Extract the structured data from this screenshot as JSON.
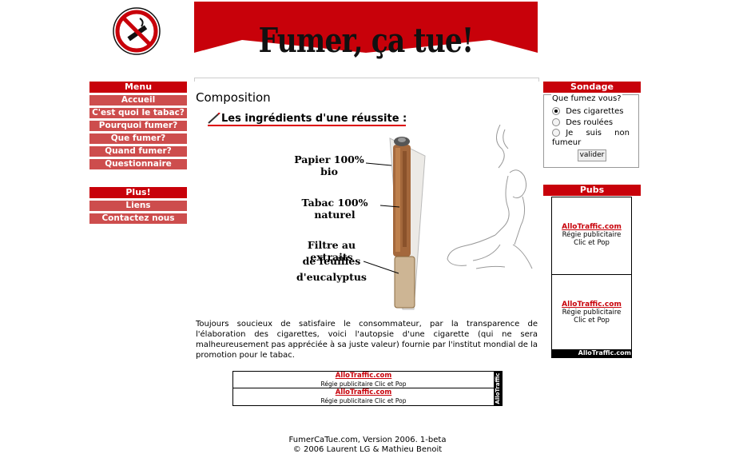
{
  "banner": {
    "title": "Fumer, ça tue!"
  },
  "menu": {
    "title": "Menu",
    "items": [
      {
        "label": "Accueil"
      },
      {
        "label": "C'est quoi le tabac?"
      },
      {
        "label": "Pourquoi fumer?"
      },
      {
        "label": "Que fumer?"
      },
      {
        "label": "Quand fumer?"
      },
      {
        "label": "Questionnaire"
      }
    ]
  },
  "plus": {
    "title": "Plus!",
    "items": [
      {
        "label": "Liens"
      },
      {
        "label": "Contactez nous"
      }
    ]
  },
  "main": {
    "heading": "Composition",
    "subheading": "Les ingrédients d'une réussite :",
    "labels": {
      "paper": "Papier 100% bio",
      "tobacco": "Tabac 100% naturel",
      "filter_1": "Filtre au extraits",
      "filter_2": "de feuilles",
      "filter_3": "d'eucalyptus"
    },
    "description": "Toujours soucieux de satisfaire le consommateur, par la transparence de l'élaboration des cigarettes, voici l'autopsie d'une cigarette (qui ne sera malheureusement pas appréciée à sa juste valeur) fournie par l'institut mondial de la promotion pour le tabac."
  },
  "poll": {
    "title": "Sondage",
    "question": "Que fumez vous?",
    "options": [
      {
        "label": "Des cigarettes",
        "selected": true
      },
      {
        "label": "Des roulées",
        "selected": false
      },
      {
        "label": "Je suis non fumeur",
        "selected": false
      }
    ],
    "submit": "valider"
  },
  "pubs": {
    "title": "Pubs",
    "ads": [
      {
        "link": "AlloTraffic.com",
        "text": "Régie publicitaire Clic et Pop"
      },
      {
        "link": "AlloTraffic.com",
        "text": "Régie publicitaire Clic et Pop"
      }
    ],
    "brand": "AlloTraffic.com"
  },
  "bottom_ads": {
    "ads": [
      {
        "link": "AlloTraffic.com",
        "text": "Régie publicitaire Clic et Pop"
      },
      {
        "link": "AlloTraffic.com",
        "text": "Régie publicitaire Clic et Pop"
      }
    ],
    "brand": "AlloTraffic"
  },
  "footer": {
    "line1": "FumerCaTue.com, Version 2006. 1-beta",
    "line2": "© 2006 Laurent LG & Mathieu Benoit"
  },
  "colors": {
    "brand_red": "#c8010a",
    "menu_item": "#cd4d4d"
  }
}
